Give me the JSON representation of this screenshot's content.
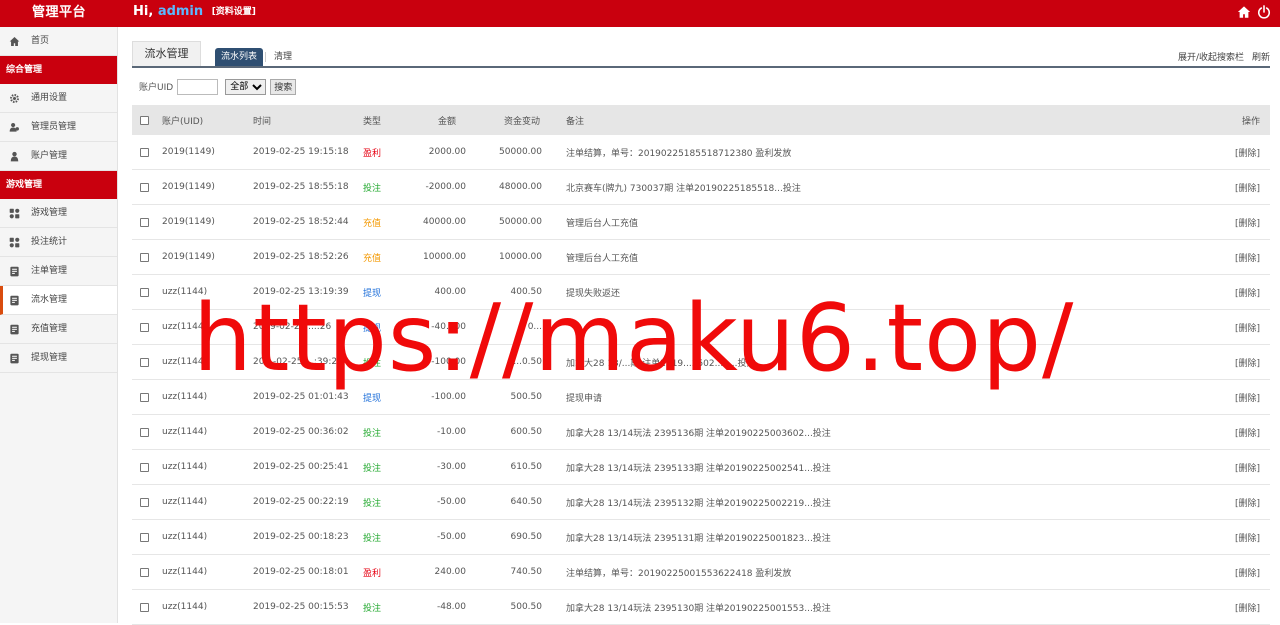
{
  "topbar": {
    "brand": "管理平台",
    "greeting": "Hi,",
    "username": "admin",
    "profile_link": "[资料设置]",
    "icons": [
      "home-icon",
      "power-icon"
    ],
    "bg_color": "#c9000e"
  },
  "sidebar": {
    "home": "首页",
    "sections": [
      {
        "title": "综合管理",
        "items": [
          "通用设置",
          "管理员管理",
          "账户管理"
        ]
      },
      {
        "title": "游戏管理",
        "items": [
          "游戏管理",
          "投注统计",
          "注单管理",
          "流水管理",
          "充值管理",
          "提现管理"
        ]
      }
    ],
    "active_item": "流水管理"
  },
  "page": {
    "title": "流水管理",
    "tab_list": "流水列表",
    "tab_clean": "清理",
    "toggle_search": "展开/收起搜索栏",
    "refresh": "刷新"
  },
  "filter": {
    "uid_label": "账户UID",
    "uid_value": "",
    "select_value": "全部",
    "search_button": "搜索"
  },
  "table": {
    "columns": [
      "账户(UID)",
      "时间",
      "类型",
      "金额",
      "资金变动",
      "备注",
      "操作"
    ],
    "type_colors": {
      "盈利": "#e60012",
      "投注": "#22a82e",
      "充值": "#f39800",
      "提现": "#1e6fd9"
    },
    "rows": [
      {
        "uid": "2019(1149)",
        "time": "2019-02-25 19:15:18",
        "type": "盈利",
        "amount": "2000.00",
        "balance": "50000.00",
        "note": "注单结算，单号：20190225185518712380 盈利发放",
        "op": "[删除]"
      },
      {
        "uid": "2019(1149)",
        "time": "2019-02-25 18:55:18",
        "type": "投注",
        "amount": "-2000.00",
        "balance": "48000.00",
        "note": "北京赛车(牌九) 730037期 注单20190225185518...投注",
        "op": "[删除]"
      },
      {
        "uid": "2019(1149)",
        "time": "2019-02-25 18:52:44",
        "type": "充值",
        "amount": "40000.00",
        "balance": "50000.00",
        "note": "管理后台人工充值",
        "op": "[删除]"
      },
      {
        "uid": "2019(1149)",
        "time": "2019-02-25 18:52:26",
        "type": "充值",
        "amount": "10000.00",
        "balance": "10000.00",
        "note": "管理后台人工充值",
        "op": "[删除]"
      },
      {
        "uid": "uzz(1144)",
        "time": "2019-02-25 13:19:39",
        "type": "提现",
        "amount": "400.00",
        "balance": "400.50",
        "note": "提现失败返还",
        "op": "[删除]"
      },
      {
        "uid": "uzz(1144)",
        "time": "2019-02-25 ...:26",
        "type": "提现",
        "amount": "-40...00",
        "balance": "0...",
        "note": "",
        "op": "[删除]"
      },
      {
        "uid": "uzz(1144)",
        "time": "20...-02-25 ...:39:21",
        "type": "投注",
        "amount": "-100.00",
        "balance": "...0.50",
        "note": "加拿大28 13/...期 注单2019...2502...1...投注",
        "op": "[删除]"
      },
      {
        "uid": "uzz(1144)",
        "time": "2019-02-25 01:01:43",
        "type": "提现",
        "amount": "-100.00",
        "balance": "500.50",
        "note": "提现申请",
        "op": "[删除]"
      },
      {
        "uid": "uzz(1144)",
        "time": "2019-02-25 00:36:02",
        "type": "投注",
        "amount": "-10.00",
        "balance": "600.50",
        "note": "加拿大28 13/14玩法 2395136期 注单20190225003602...投注",
        "op": "[删除]"
      },
      {
        "uid": "uzz(1144)",
        "time": "2019-02-25 00:25:41",
        "type": "投注",
        "amount": "-30.00",
        "balance": "610.50",
        "note": "加拿大28 13/14玩法 2395133期 注单20190225002541...投注",
        "op": "[删除]"
      },
      {
        "uid": "uzz(1144)",
        "time": "2019-02-25 00:22:19",
        "type": "投注",
        "amount": "-50.00",
        "balance": "640.50",
        "note": "加拿大28 13/14玩法 2395132期 注单20190225002219...投注",
        "op": "[删除]"
      },
      {
        "uid": "uzz(1144)",
        "time": "2019-02-25 00:18:23",
        "type": "投注",
        "amount": "-50.00",
        "balance": "690.50",
        "note": "加拿大28 13/14玩法 2395131期 注单20190225001823...投注",
        "op": "[删除]"
      },
      {
        "uid": "uzz(1144)",
        "time": "2019-02-25 00:18:01",
        "type": "盈利",
        "amount": "240.00",
        "balance": "740.50",
        "note": "注单结算，单号：20190225001553622418 盈利发放",
        "op": "[删除]"
      },
      {
        "uid": "uzz(1144)",
        "time": "2019-02-25 00:15:53",
        "type": "投注",
        "amount": "-48.00",
        "balance": "500.50",
        "note": "加拿大28 13/14玩法 2395130期 注单20190225001553...投注",
        "op": "[删除]"
      }
    ]
  },
  "watermark": "https://maku6.top/"
}
